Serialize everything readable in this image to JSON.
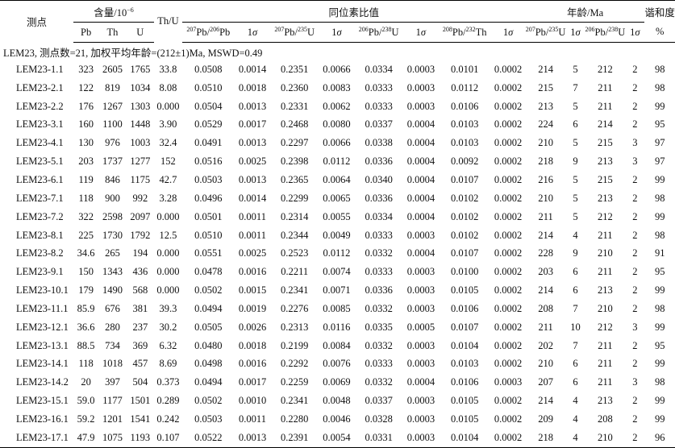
{
  "header": {
    "point": "测点",
    "content_group": "含量/10",
    "content_exp": "−6",
    "thu": "Th/U",
    "isotope_group": "同位素比值",
    "age_group": "年龄/Ma",
    "concordance": "谐和度",
    "pb": "Pb",
    "th": "Th",
    "u": "U",
    "r1_num_mass": "207",
    "r1_num_el": "Pb/",
    "r1_den_mass": "206",
    "r1_den_el": "Pb",
    "r2_num_mass": "207",
    "r2_num_el": "Pb/",
    "r2_den_mass": "235",
    "r2_den_el": "U",
    "r3_num_mass": "206",
    "r3_num_el": "Pb/",
    "r3_den_mass": "238",
    "r3_den_el": "U",
    "r4_num_mass": "208",
    "r4_num_el": "Pb/",
    "r4_den_mass": "232",
    "r4_den_el": "Th",
    "a1_num_mass": "207",
    "a1_num_el": "Pb/",
    "a1_den_mass": "235",
    "a1_den_el": "U",
    "a2_num_mass": "206",
    "a2_num_el": "Pb/",
    "a2_den_mass": "238",
    "a2_den_el": "U",
    "sigma_one": "1",
    "sigma_sym": "σ",
    "percent": "%"
  },
  "summary": "LEM23, 测点数=21, 加权平均年龄=(212±1)Ma, MSWD=0.49",
  "rows": [
    [
      "LEM23-1.1",
      "323",
      "2605",
      "1765",
      "33.8",
      "0.0508",
      "0.0014",
      "0.2351",
      "0.0066",
      "0.0334",
      "0.0003",
      "0.0101",
      "0.0002",
      "214",
      "5",
      "212",
      "2",
      "98"
    ],
    [
      "LEM23-2.1",
      "122",
      "819",
      "1034",
      "8.08",
      "0.0510",
      "0.0018",
      "0.2360",
      "0.0083",
      "0.0333",
      "0.0003",
      "0.0112",
      "0.0002",
      "215",
      "7",
      "211",
      "2",
      "98"
    ],
    [
      "LEM23-2.2",
      "176",
      "1267",
      "1303",
      "0.000",
      "0.0504",
      "0.0013",
      "0.2331",
      "0.0062",
      "0.0333",
      "0.0003",
      "0.0106",
      "0.0002",
      "213",
      "5",
      "211",
      "2",
      "99"
    ],
    [
      "LEM23-3.1",
      "160",
      "1100",
      "1448",
      "3.90",
      "0.0529",
      "0.0017",
      "0.2468",
      "0.0080",
      "0.0337",
      "0.0004",
      "0.0103",
      "0.0002",
      "224",
      "6",
      "214",
      "2",
      "95"
    ],
    [
      "LEM23-4.1",
      "130",
      "976",
      "1003",
      "32.4",
      "0.0491",
      "0.0013",
      "0.2297",
      "0.0066",
      "0.0338",
      "0.0004",
      "0.0103",
      "0.0002",
      "210",
      "5",
      "215",
      "3",
      "97"
    ],
    [
      "LEM23-5.1",
      "203",
      "1737",
      "1277",
      "152",
      "0.0516",
      "0.0025",
      "0.2398",
      "0.0112",
      "0.0336",
      "0.0004",
      "0.0092",
      "0.0002",
      "218",
      "9",
      "213",
      "3",
      "97"
    ],
    [
      "LEM23-6.1",
      "119",
      "846",
      "1175",
      "42.7",
      "0.0503",
      "0.0013",
      "0.2365",
      "0.0064",
      "0.0340",
      "0.0004",
      "0.0107",
      "0.0002",
      "216",
      "5",
      "215",
      "2",
      "99"
    ],
    [
      "LEM23-7.1",
      "118",
      "900",
      "992",
      "3.28",
      "0.0496",
      "0.0014",
      "0.2299",
      "0.0065",
      "0.0336",
      "0.0004",
      "0.0102",
      "0.0002",
      "210",
      "5",
      "213",
      "2",
      "98"
    ],
    [
      "LEM23-7.2",
      "322",
      "2598",
      "2097",
      "0.000",
      "0.0501",
      "0.0011",
      "0.2314",
      "0.0055",
      "0.0334",
      "0.0004",
      "0.0102",
      "0.0002",
      "211",
      "5",
      "212",
      "2",
      "99"
    ],
    [
      "LEM23-8.1",
      "225",
      "1730",
      "1792",
      "12.5",
      "0.0510",
      "0.0011",
      "0.2344",
      "0.0049",
      "0.0333",
      "0.0003",
      "0.0102",
      "0.0002",
      "214",
      "4",
      "211",
      "2",
      "98"
    ],
    [
      "LEM23-8.2",
      "34.6",
      "265",
      "194",
      "0.000",
      "0.0551",
      "0.0025",
      "0.2523",
      "0.0112",
      "0.0332",
      "0.0004",
      "0.0107",
      "0.0002",
      "228",
      "9",
      "210",
      "2",
      "91"
    ],
    [
      "LEM23-9.1",
      "150",
      "1343",
      "436",
      "0.000",
      "0.0478",
      "0.0016",
      "0.2211",
      "0.0074",
      "0.0333",
      "0.0003",
      "0.0100",
      "0.0002",
      "203",
      "6",
      "211",
      "2",
      "95"
    ],
    [
      "LEM23-10.1",
      "179",
      "1490",
      "568",
      "0.000",
      "0.0502",
      "0.0015",
      "0.2341",
      "0.0071",
      "0.0336",
      "0.0003",
      "0.0105",
      "0.0002",
      "214",
      "6",
      "213",
      "2",
      "99"
    ],
    [
      "LEM23-11.1",
      "85.9",
      "676",
      "381",
      "39.3",
      "0.0494",
      "0.0019",
      "0.2276",
      "0.0085",
      "0.0332",
      "0.0003",
      "0.0106",
      "0.0002",
      "208",
      "7",
      "210",
      "2",
      "98"
    ],
    [
      "LEM23-12.1",
      "36.6",
      "280",
      "237",
      "30.2",
      "0.0505",
      "0.0026",
      "0.2313",
      "0.0116",
      "0.0335",
      "0.0005",
      "0.0107",
      "0.0002",
      "211",
      "10",
      "212",
      "3",
      "99"
    ],
    [
      "LEM23-13.1",
      "88.5",
      "734",
      "369",
      "6.32",
      "0.0480",
      "0.0018",
      "0.2199",
      "0.0084",
      "0.0332",
      "0.0003",
      "0.0104",
      "0.0002",
      "202",
      "7",
      "211",
      "2",
      "95"
    ],
    [
      "LEM23-14.1",
      "118",
      "1018",
      "457",
      "8.69",
      "0.0498",
      "0.0016",
      "0.2292",
      "0.0076",
      "0.0333",
      "0.0003",
      "0.0103",
      "0.0002",
      "210",
      "6",
      "211",
      "2",
      "99"
    ],
    [
      "LEM23-14.2",
      "20",
      "397",
      "504",
      "0.373",
      "0.0494",
      "0.0017",
      "0.2259",
      "0.0069",
      "0.0332",
      "0.0004",
      "0.0106",
      "0.0003",
      "207",
      "6",
      "211",
      "3",
      "98"
    ],
    [
      "LEM23-15.1",
      "59.0",
      "1177",
      "1501",
      "0.289",
      "0.0502",
      "0.0010",
      "0.2341",
      "0.0048",
      "0.0337",
      "0.0003",
      "0.0105",
      "0.0002",
      "214",
      "4",
      "213",
      "2",
      "99"
    ],
    [
      "LEM23-16.1",
      "59.2",
      "1201",
      "1541",
      "0.242",
      "0.0503",
      "0.0011",
      "0.2280",
      "0.0046",
      "0.0328",
      "0.0003",
      "0.0105",
      "0.0002",
      "209",
      "4",
      "208",
      "2",
      "99"
    ],
    [
      "LEM23-17.1",
      "47.9",
      "1075",
      "1193",
      "0.107",
      "0.0522",
      "0.0013",
      "0.2391",
      "0.0054",
      "0.0331",
      "0.0003",
      "0.0104",
      "0.0002",
      "218",
      "4",
      "210",
      "2",
      "96"
    ]
  ]
}
